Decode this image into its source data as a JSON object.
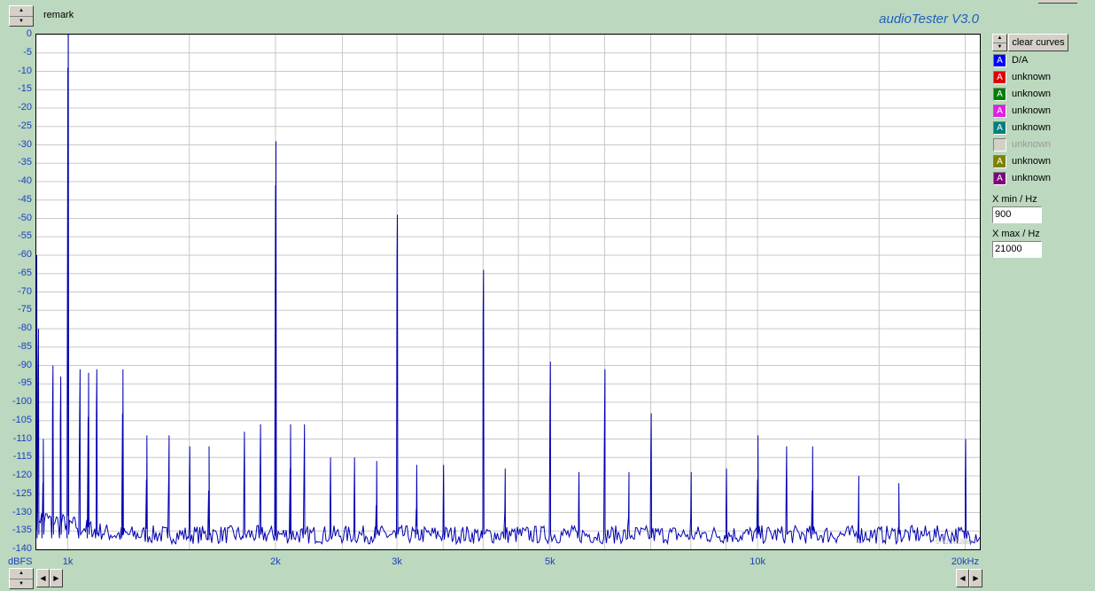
{
  "header": {
    "remark_label": "remark",
    "app_title": "audioTester  V3.0"
  },
  "controls": {
    "clear_curves_label": "clear curves",
    "x_min_label": "X min / Hz",
    "x_min_value": "900",
    "x_max_label": "X max / Hz",
    "x_max_value": "21000",
    "watermark": "© U.Müller"
  },
  "legend": [
    {
      "glyph": "A",
      "label": "D/A",
      "color": "#0000ff",
      "enabled": true
    },
    {
      "glyph": "A",
      "label": "unknown",
      "color": "#e00000",
      "enabled": true
    },
    {
      "glyph": "A",
      "label": "unknown",
      "color": "#008000",
      "enabled": true
    },
    {
      "glyph": "A",
      "label": "unknown",
      "color": "#e020e0",
      "enabled": true
    },
    {
      "glyph": "A",
      "label": "unknown",
      "color": "#008080",
      "enabled": true
    },
    {
      "glyph": "",
      "label": "unknown",
      "color": "#d4d0c8",
      "enabled": false
    },
    {
      "glyph": "A",
      "label": "unknown",
      "color": "#808000",
      "enabled": true
    },
    {
      "glyph": "A",
      "label": "unknown",
      "color": "#800080",
      "enabled": true
    }
  ],
  "chart_data": {
    "type": "line",
    "x_scale": "log",
    "xlim": [
      900,
      21000
    ],
    "ylim": [
      -140,
      0
    ],
    "y_unit": "dBFS",
    "y_ticks": [
      "0",
      "-5",
      "-10",
      "-15",
      "-20",
      "-25",
      "-30",
      "-35",
      "-40",
      "-45",
      "-50",
      "-55",
      "-60",
      "-65",
      "-70",
      "-75",
      "-80",
      "-85",
      "-90",
      "-95",
      "-100",
      "-105",
      "-110",
      "-115",
      "-120",
      "-125",
      "-130",
      "-135",
      "-140"
    ],
    "x_ticks": [
      {
        "value": 1000,
        "label": "1k"
      },
      {
        "value": 2000,
        "label": "2k"
      },
      {
        "value": 3000,
        "label": "3k"
      },
      {
        "value": 5000,
        "label": "5k"
      },
      {
        "value": 10000,
        "label": "10k"
      },
      {
        "value": 20000,
        "label": "20kHz"
      }
    ],
    "grid": true,
    "noise_floor": -136,
    "series": [
      {
        "name": "D/A",
        "color": "#0000b0",
        "peaks": [
          [
            900,
            -72
          ],
          [
            905,
            -92
          ],
          [
            920,
            -122
          ],
          [
            950,
            -102
          ],
          [
            975,
            -105
          ],
          [
            1000,
            -9
          ],
          [
            1040,
            -103
          ],
          [
            1070,
            -104
          ],
          [
            1100,
            -103
          ],
          [
            1200,
            -103
          ],
          [
            1300,
            -121
          ],
          [
            1400,
            -121
          ],
          [
            1500,
            -124
          ],
          [
            1600,
            -124
          ],
          [
            1800,
            -120
          ],
          [
            1900,
            -118
          ],
          [
            2000,
            -41
          ],
          [
            2100,
            -118
          ],
          [
            2200,
            -118
          ],
          [
            2400,
            -127
          ],
          [
            2600,
            -127
          ],
          [
            2800,
            -128
          ],
          [
            3000,
            -61
          ],
          [
            3200,
            -129
          ],
          [
            3500,
            -129
          ],
          [
            4000,
            -76
          ],
          [
            4300,
            -130
          ],
          [
            5000,
            -101
          ],
          [
            5500,
            -131
          ],
          [
            6000,
            -103
          ],
          [
            6500,
            -131
          ],
          [
            7000,
            -115
          ],
          [
            8000,
            -131
          ],
          [
            9000,
            -130
          ],
          [
            10000,
            -121
          ],
          [
            11000,
            -124
          ],
          [
            12000,
            -124
          ],
          [
            14000,
            -132
          ],
          [
            16000,
            -134
          ],
          [
            20000,
            -122
          ]
        ]
      }
    ]
  }
}
